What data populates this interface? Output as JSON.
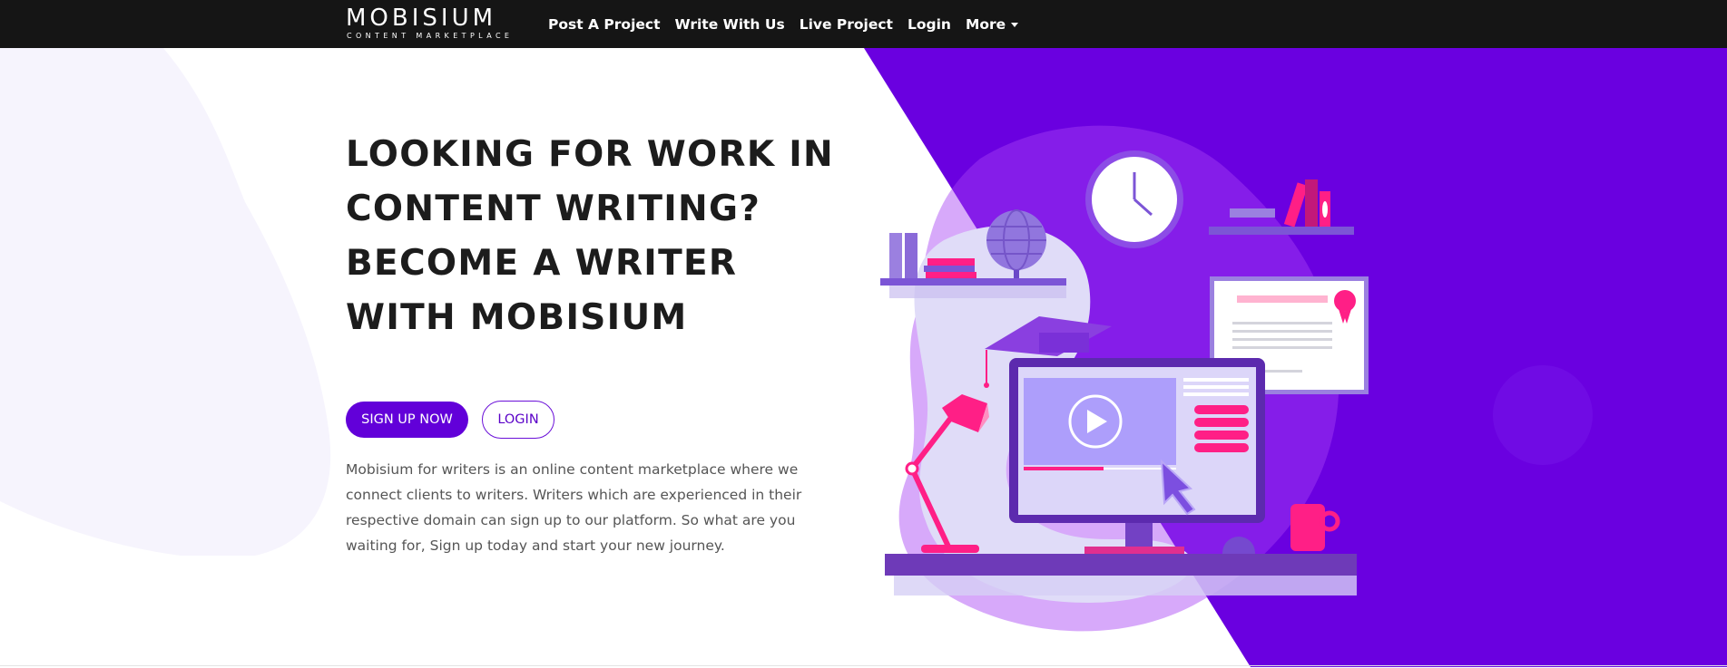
{
  "brand": {
    "name": "MOBISIUM",
    "tagline": "CONTENT MARKETPLACE"
  },
  "nav": {
    "items": [
      {
        "label": "Post A Project"
      },
      {
        "label": "Write With Us"
      },
      {
        "label": "Live Project"
      },
      {
        "label": "Login"
      },
      {
        "label": "More"
      }
    ]
  },
  "hero": {
    "headline": "LOOKING FOR WORK IN CONTENT WRITING? BECOME A WRITER WITH MOBISIUM",
    "primary_button": "SIGN UP NOW",
    "secondary_button": "LOGIN",
    "description": "Mobisium for writers is an online content marketplace where we connect clients to writers. Writers which are experienced in their respective domain can sign up to our platform. So what are you waiting for, Sign up today and start your new journey."
  },
  "colors": {
    "navbar": "#151515",
    "accent": "#6200d9",
    "hero_purple": "#6a00e0",
    "pink": "#ff0a78",
    "headline": "#1c1c1c",
    "body_text": "#555555"
  },
  "icons": {
    "more_dropdown": "caret-down-icon",
    "video_play": "play-icon"
  }
}
